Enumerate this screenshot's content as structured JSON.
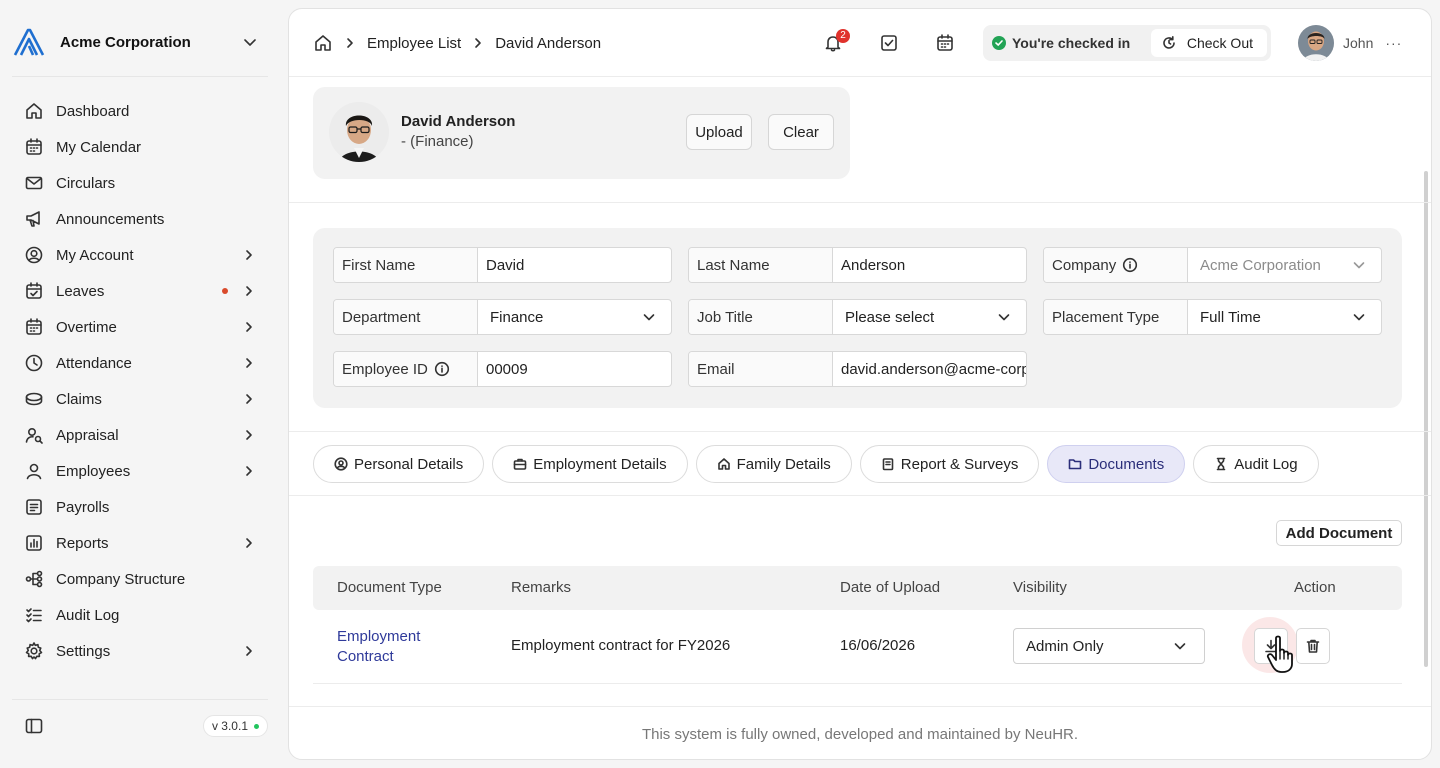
{
  "sidebar": {
    "org_name": "Acme Corporation",
    "items": [
      {
        "label": "Dashboard",
        "icon": "home-icon",
        "has_children": false
      },
      {
        "label": "My Calendar",
        "icon": "calendar-icon",
        "has_children": false
      },
      {
        "label": "Circulars",
        "icon": "mail-icon",
        "has_children": false
      },
      {
        "label": "Announcements",
        "icon": "megaphone-icon",
        "has_children": false
      },
      {
        "label": "My Account",
        "icon": "user-circle-icon",
        "has_children": true
      },
      {
        "label": "Leaves",
        "icon": "calendar-check-icon",
        "has_children": true,
        "dot": true
      },
      {
        "label": "Overtime",
        "icon": "calendar-clock-icon",
        "has_children": true
      },
      {
        "label": "Attendance",
        "icon": "clock-icon",
        "has_children": true
      },
      {
        "label": "Claims",
        "icon": "coins-icon",
        "has_children": true
      },
      {
        "label": "Appraisal",
        "icon": "user-search-icon",
        "has_children": true
      },
      {
        "label": "Employees",
        "icon": "user-icon",
        "has_children": true
      },
      {
        "label": "Payrolls",
        "icon": "receipt-icon",
        "has_children": false
      },
      {
        "label": "Reports",
        "icon": "chart-icon",
        "has_children": true
      },
      {
        "label": "Company Structure",
        "icon": "org-chart-icon",
        "has_children": false
      },
      {
        "label": "Audit Log",
        "icon": "list-check-icon",
        "has_children": false
      },
      {
        "label": "Settings",
        "icon": "gear-icon",
        "has_children": true
      }
    ],
    "version": "v 3.0.1"
  },
  "topbar": {
    "breadcrumbs": [
      "Employee List",
      "David Anderson"
    ],
    "notification_count": "2",
    "checkin_status": "You're checked in",
    "checkout_label": "Check Out",
    "user_name": "John",
    "more": "···"
  },
  "profile": {
    "name": "David Anderson",
    "department": "- (Finance)",
    "upload_label": "Upload",
    "clear_label": "Clear"
  },
  "form": {
    "first_name": {
      "label": "First Name",
      "value": "David"
    },
    "last_name": {
      "label": "Last Name",
      "value": "Anderson"
    },
    "company": {
      "label": "Company",
      "value": "Acme Corporation"
    },
    "department": {
      "label": "Department",
      "value": "Finance"
    },
    "job_title": {
      "label": "Job Title",
      "value": "Please select"
    },
    "placement_type": {
      "label": "Placement Type",
      "value": "Full Time"
    },
    "employee_id": {
      "label": "Employee ID",
      "value": "00009"
    },
    "email": {
      "label": "Email",
      "value": "david.anderson@acme-corp.com"
    }
  },
  "tabs": [
    {
      "label": "Personal Details",
      "icon": "user-circle-icon"
    },
    {
      "label": "Employment Details",
      "icon": "briefcase-icon"
    },
    {
      "label": "Family Details",
      "icon": "home-icon"
    },
    {
      "label": "Report & Surveys",
      "icon": "clipboard-icon"
    },
    {
      "label": "Documents",
      "icon": "folder-icon",
      "active": true
    },
    {
      "label": "Audit Log",
      "icon": "hourglass-icon"
    }
  ],
  "documents": {
    "add_label": "Add Document",
    "columns": [
      "Document Type",
      "Remarks",
      "Date of Upload",
      "Visibility",
      "Action"
    ],
    "rows": [
      {
        "type": "Employment Contract",
        "remarks": "Employment contract for FY2026",
        "date": "16/06/2026",
        "visibility": "Admin Only"
      }
    ]
  },
  "footer": {
    "text": "This system is fully owned, developed and maintained by NeuHR."
  },
  "colors": {
    "accent": "#2f3a9a",
    "active_tab_bg": "#e8e8f8",
    "badge_red": "#e0322c",
    "checked_in_green": "#22a355"
  }
}
